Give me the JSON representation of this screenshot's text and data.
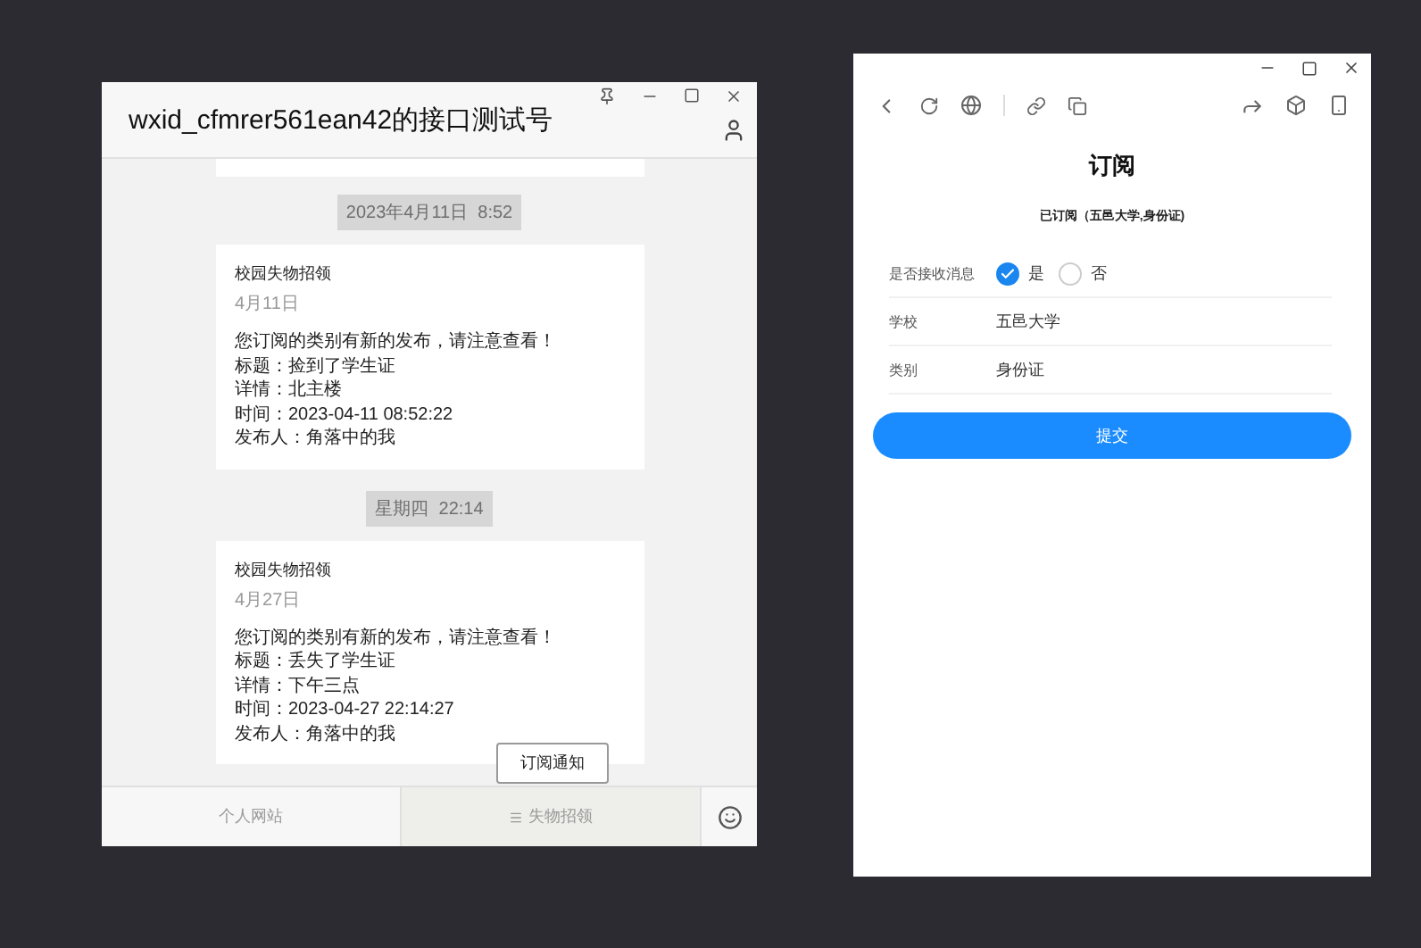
{
  "chat_window": {
    "title": "wxid_cfmrer561ean42的接口测试号",
    "messages": [
      {
        "kind": "clipped"
      },
      {
        "kind": "time",
        "text": "2023年4月11日  8:52"
      },
      {
        "kind": "card",
        "source": "校园失物招领",
        "date": "4月11日",
        "lines": [
          "您订阅的类别有新的发布，请注意查看！",
          "标题：捡到了学生证",
          "详情：北主楼",
          "时间：2023-04-11 08:52:22",
          "发布人：角落中的我"
        ]
      },
      {
        "kind": "time",
        "text": "星期四  22:14"
      },
      {
        "kind": "card",
        "source": "校园失物招领",
        "date": "4月27日",
        "lines": [
          "您订阅的类别有新的发布，请注意查看！",
          "标题：丢失了学生证",
          "详情：下午三点",
          "时间：2023-04-27 22:14:27",
          "发布人：角落中的我"
        ]
      }
    ],
    "popup": "订阅通知",
    "menu": [
      {
        "label": "个人网站",
        "selected": false,
        "has_list_icon": false
      },
      {
        "label": "失物招领",
        "selected": true,
        "has_list_icon": true
      }
    ]
  },
  "browser_window": {
    "title": "订阅",
    "subtitle": "已订阅（五邑大学,身份证)",
    "receive": {
      "label": "是否接收消息",
      "options": [
        {
          "label": "是",
          "selected": true
        },
        {
          "label": "否",
          "selected": false
        }
      ]
    },
    "fields": [
      {
        "label": "学校",
        "value": "五邑大学"
      },
      {
        "label": "类别",
        "value": "身份证"
      }
    ],
    "submit": "提交"
  }
}
